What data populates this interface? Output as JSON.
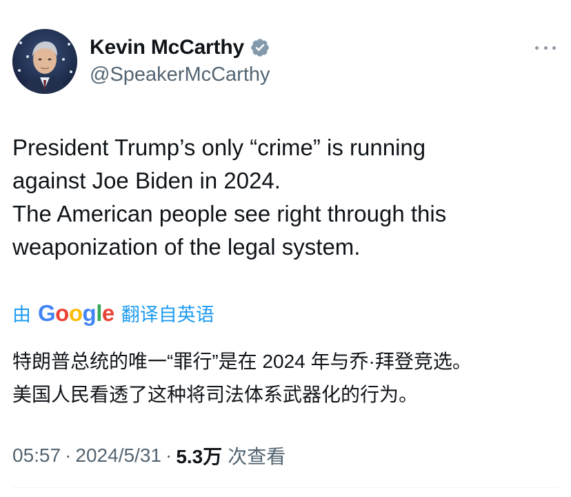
{
  "author": {
    "display_name": "Kevin McCarthy",
    "handle": "@SpeakerMcCarthy",
    "verified_color": "#829aab",
    "avatar": "avatar-photo"
  },
  "tweet": {
    "lines": [
      "President Trump’s only “crime” is running",
      "against Joe Biden in 2024.",
      "The American people see right through this",
      "weaponization of the legal system."
    ]
  },
  "translation": {
    "prefix": "由",
    "google_letters": [
      "G",
      "o",
      "o",
      "g",
      "l",
      "e"
    ],
    "suffix": "翻译自英语",
    "lines": [
      "特朗普总统的唯一“罪行”是在 2024 年与乔·拜登竞选。",
      "美国人民看透了这种将司法体系武器化的行为。"
    ]
  },
  "meta": {
    "time": "05:57",
    "date": "2024/5/31",
    "views_count": "5.3万",
    "views_label": "次查看",
    "separator": "·"
  },
  "colors": {
    "link": "#1d9bf0",
    "secondary_text": "#536471",
    "primary_text": "#0f1419"
  }
}
